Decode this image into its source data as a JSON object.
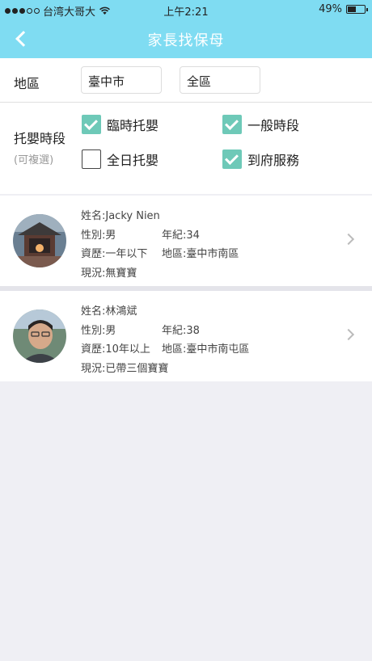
{
  "status": {
    "carrier": "台湾大哥大",
    "time": "上午2:21",
    "battery": "49%",
    "battery_level": 0.49
  },
  "nav": {
    "title": "家長找保母",
    "back_icon": "chevron-left-icon"
  },
  "filters": {
    "area_label": "地區",
    "city": "臺中市",
    "district": "全區",
    "care_label": "托嬰時段",
    "care_hint": "(可複選)",
    "options": [
      {
        "label": "臨時托嬰",
        "checked": true
      },
      {
        "label": "一般時段",
        "checked": true
      },
      {
        "label": "全日托嬰",
        "checked": false
      },
      {
        "label": "到府服務",
        "checked": true
      }
    ]
  },
  "nannies": [
    {
      "name": "姓名:Jacky Nien",
      "gender": "性別:男",
      "age": "年紀:34",
      "experience": "資歷:一年以下",
      "region": "地區:臺中市南區",
      "status": "現況:無寶寶"
    },
    {
      "name": "姓名:林鴻斌",
      "gender": "性別:男",
      "age": "年紀:38",
      "experience": "資歷:10年以上",
      "region": "地區:臺中市南屯區",
      "status": "現況:已帶三個寶寶"
    }
  ],
  "colors": {
    "header": "#7fdcf2",
    "checkbox": "#6ec9b8"
  }
}
